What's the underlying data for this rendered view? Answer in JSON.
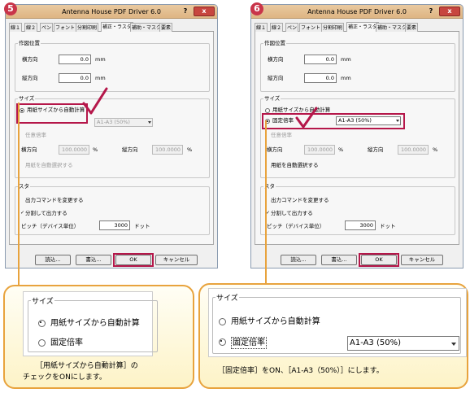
{
  "dialog": {
    "title": "Antenna House PDF Driver 6.0",
    "help": "?",
    "close": "x",
    "tabs": [
      "線１",
      "線２",
      "ペン",
      "フォント",
      "分割印刷",
      "補正・ラスタ",
      "補助・マスク",
      "要素"
    ],
    "pos_group": "作図位置",
    "x_label": "横方向",
    "y_label": "縦方向",
    "x_value": "0.0",
    "y_value": "0.0",
    "unit_mm": "mm",
    "size_group": "サイズ",
    "auto_calc": "用紙サイズから自動計算",
    "fixed_ratio": "固定倍率",
    "ratio_value": "A1-A3 (50%)",
    "free_ratio": "任意倍率",
    "h_label": "横方向",
    "v_label": "縦方向",
    "h_value": "100.0000",
    "v_value": "100.0000",
    "pct": "%",
    "auto_select": "用紙を自動選択する",
    "raster_group": "スタ",
    "raster_opt1": "出力コマンドを変更する",
    "raster_opt2": "分割して出力する",
    "pitch_label": "ピッチ（デバイス単位）",
    "pitch_value": "3000",
    "dot": "ドット",
    "btn_read": "読込...",
    "btn_write": "書込...",
    "btn_ok": "OK",
    "btn_cancel": "キャンセル"
  },
  "steps": {
    "left": "5",
    "right": "6"
  },
  "callout_left": {
    "group": "サイズ",
    "opt1": "用紙サイズから自動計算",
    "opt2": "固定倍率",
    "desc1": "［用紙サイズから自動計算］の",
    "desc2": "チェックをONにします。"
  },
  "callout_right": {
    "group": "サイズ",
    "opt1": "用紙サイズから自動計算",
    "opt2": "固定倍率",
    "select": "A1-A3 (50%)",
    "desc": "［固定倍率］をON、［A1-A3（50%）］にします。"
  },
  "colors": {
    "accent": "#b5174a",
    "callout_border": "#e8a33d",
    "titlebar": "#deb583"
  }
}
